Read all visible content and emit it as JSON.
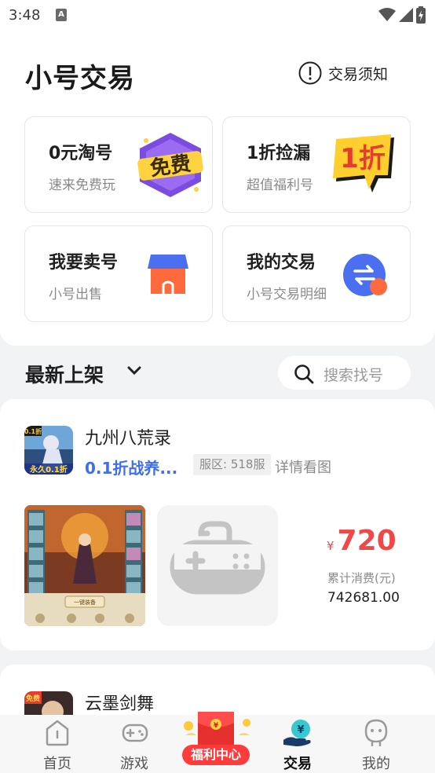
{
  "status": {
    "time": "3:48"
  },
  "header": {
    "title": "小号交易",
    "notice_label": "交易须知"
  },
  "tiles": [
    {
      "title": "0元淘号",
      "subtitle": "速来免费玩",
      "icon": "free-badge-icon",
      "badge": "免费"
    },
    {
      "title": "1折捡漏",
      "subtitle": "超值福利号",
      "icon": "discount-badge-icon",
      "badge": "1折"
    },
    {
      "title": "我要卖号",
      "subtitle": "小号出售",
      "icon": "shop-icon"
    },
    {
      "title": "我的交易",
      "subtitle": "小号交易明细",
      "icon": "exchange-icon"
    }
  ],
  "section": {
    "title": "最新上架",
    "search_placeholder": "搜索找号"
  },
  "listings": [
    {
      "game_name": "九州八荒录",
      "promo": "0.1折战养...",
      "server": "服区: 518服",
      "detail_link": "详情看图",
      "currency": "¥",
      "price": "720",
      "spend_label": "累计消费(元)",
      "spend_value": "742681.00",
      "icon_badge": "0.1折",
      "icon_caption": "永久0.1折",
      "screenshot_button": "一键装备"
    },
    {
      "game_name": "云墨剑舞",
      "icon_badge": "免费"
    }
  ],
  "tabbar": {
    "items": [
      {
        "label": "首页",
        "icon": "home-icon"
      },
      {
        "label": "游戏",
        "icon": "gamepad-icon"
      },
      {
        "label": "福利中心",
        "icon": "red-envelope-icon"
      },
      {
        "label": "交易",
        "icon": "trade-icon",
        "active": true
      },
      {
        "label": "我的",
        "icon": "profile-icon"
      }
    ]
  },
  "colors": {
    "accent": "#3f6df2",
    "price": "#f04848",
    "welfare": "#ff3b3b"
  }
}
